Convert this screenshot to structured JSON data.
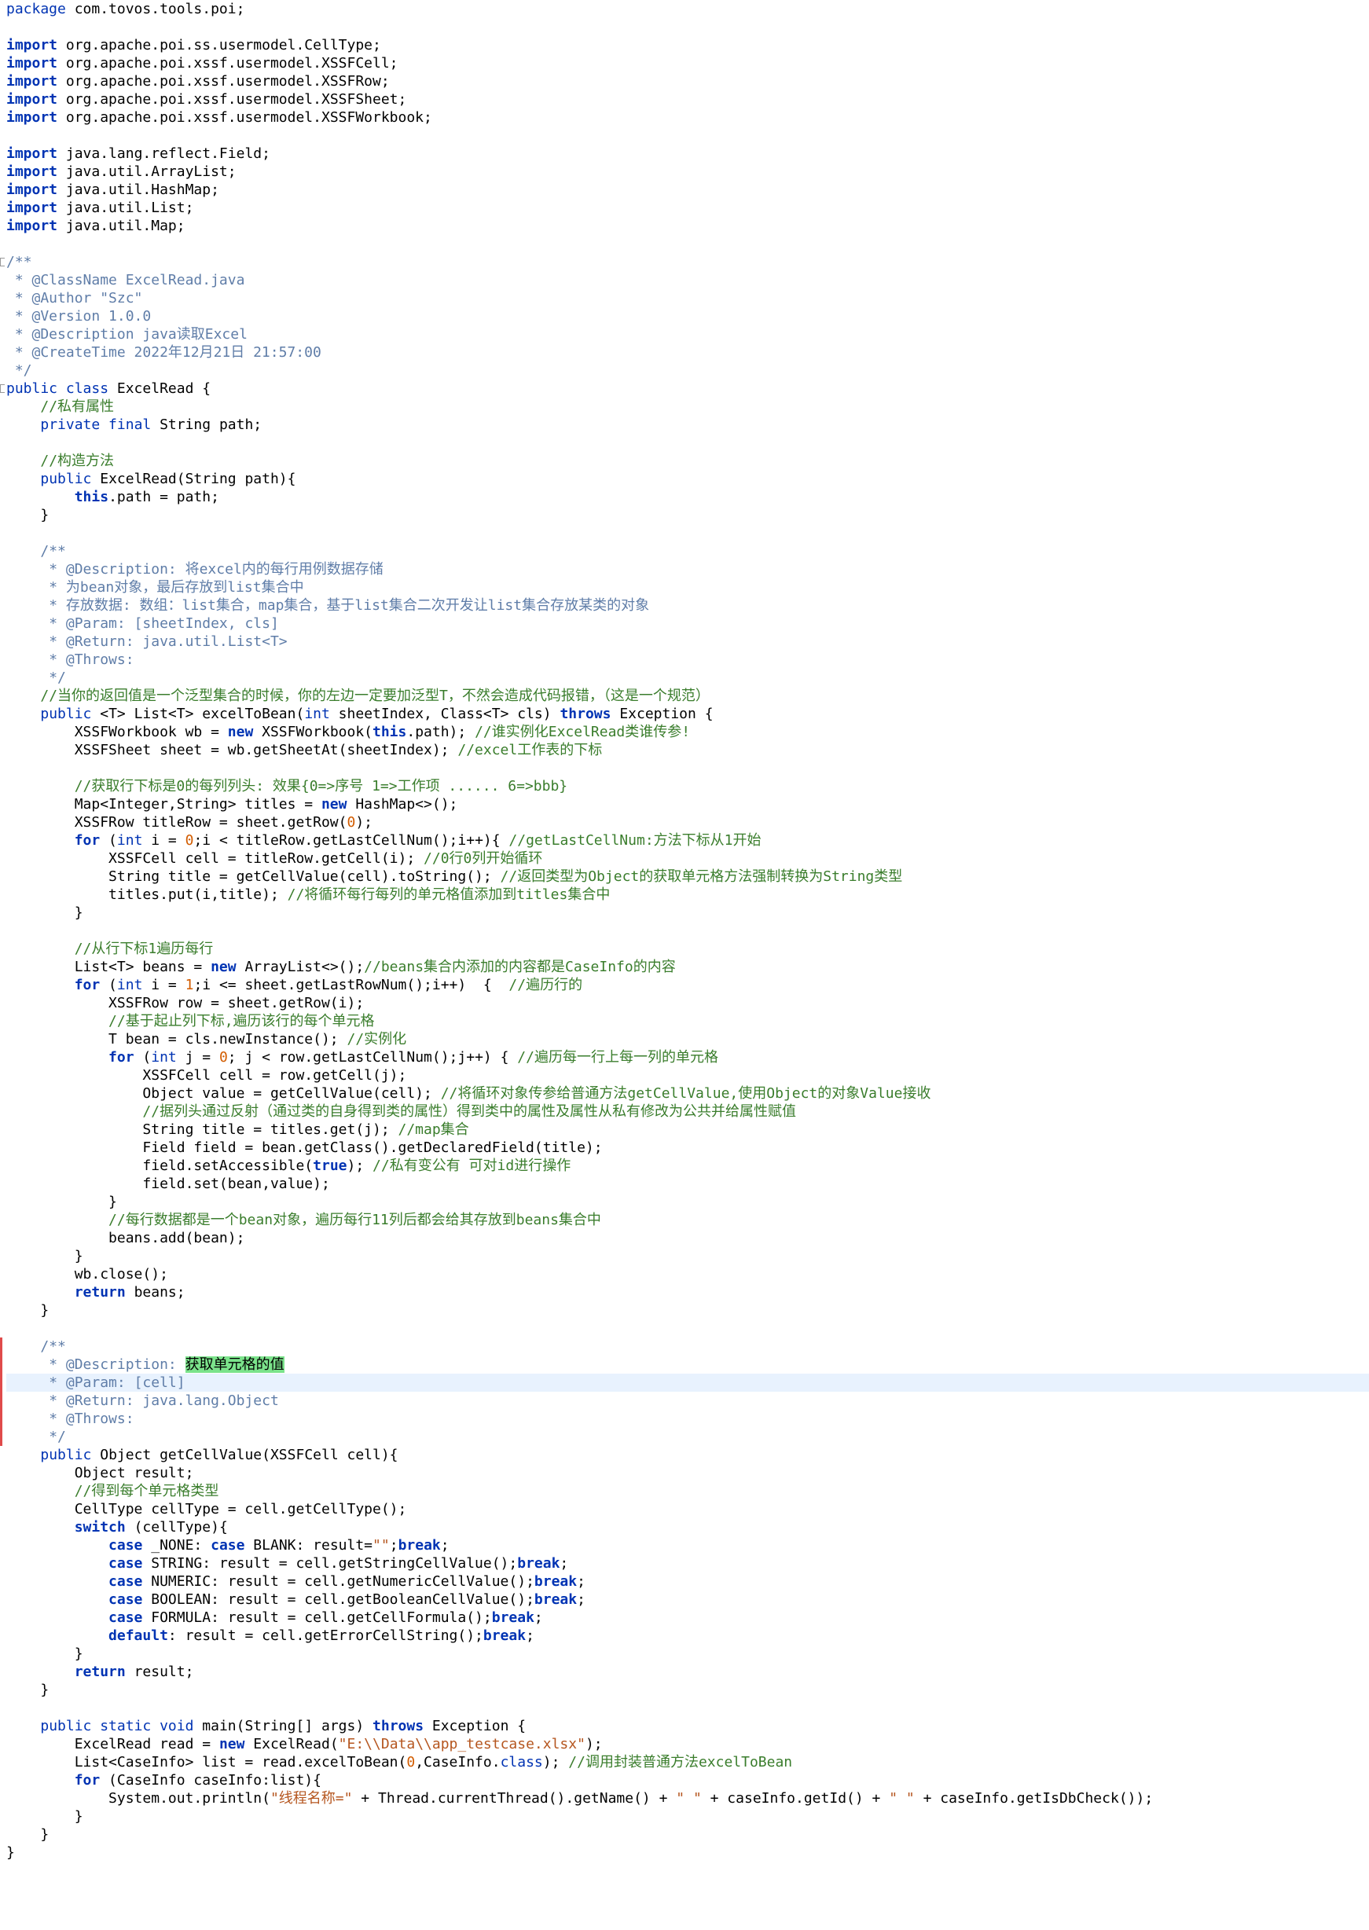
{
  "editor": {
    "lines": [
      [
        [
          "kw",
          "package"
        ],
        [
          "plain",
          " com.tovos.tools.poi;"
        ]
      ],
      [],
      [
        [
          "kwb",
          "import"
        ],
        [
          "plain",
          " org.apache.poi.ss.usermodel.CellType;"
        ]
      ],
      [
        [
          "kwb",
          "import"
        ],
        [
          "plain",
          " org.apache.poi.xssf.usermodel.XSSFCell;"
        ]
      ],
      [
        [
          "kwb",
          "import"
        ],
        [
          "plain",
          " org.apache.poi.xssf.usermodel.XSSFRow;"
        ]
      ],
      [
        [
          "kwb",
          "import"
        ],
        [
          "plain",
          " org.apache.poi.xssf.usermodel.XSSFSheet;"
        ]
      ],
      [
        [
          "kwb",
          "import"
        ],
        [
          "plain",
          " org.apache.poi.xssf.usermodel.XSSFWorkbook;"
        ]
      ],
      [],
      [
        [
          "kwb",
          "import"
        ],
        [
          "plain",
          " java.lang.reflect.Field;"
        ]
      ],
      [
        [
          "kwb",
          "import"
        ],
        [
          "plain",
          " java.util.ArrayList;"
        ]
      ],
      [
        [
          "kwb",
          "import"
        ],
        [
          "plain",
          " java.util.HashMap;"
        ]
      ],
      [
        [
          "kwb",
          "import"
        ],
        [
          "plain",
          " java.util.List;"
        ]
      ],
      [
        [
          "kwb",
          "import"
        ],
        [
          "plain",
          " java.util.Map;"
        ]
      ],
      [],
      [
        [
          "doc",
          "/**"
        ]
      ],
      [
        [
          "doc",
          " * @ClassName ExcelRead.java"
        ]
      ],
      [
        [
          "doc",
          " * @Author \"Szc\""
        ]
      ],
      [
        [
          "doc",
          " * @Version 1.0.0"
        ]
      ],
      [
        [
          "doc",
          " * @Description java读取Excel"
        ]
      ],
      [
        [
          "doc",
          " * @CreateTime 2022年12月21日 21:57:00"
        ]
      ],
      [
        [
          "doc",
          " */"
        ]
      ],
      [
        [
          "kw",
          "public class"
        ],
        [
          "plain",
          " ExcelRead {"
        ]
      ],
      [
        [
          "plain",
          "    "
        ],
        [
          "cm",
          "//私有属性"
        ]
      ],
      [
        [
          "plain",
          "    "
        ],
        [
          "kw",
          "private final"
        ],
        [
          "plain",
          " String path;"
        ]
      ],
      [],
      [
        [
          "plain",
          "    "
        ],
        [
          "cm",
          "//构造方法"
        ]
      ],
      [
        [
          "plain",
          "    "
        ],
        [
          "kw",
          "public"
        ],
        [
          "plain",
          " ExcelRead(String path){"
        ]
      ],
      [
        [
          "plain",
          "        "
        ],
        [
          "kwb",
          "this"
        ],
        [
          "plain",
          ".path = path;"
        ]
      ],
      [
        [
          "plain",
          "    }"
        ]
      ],
      [],
      [
        [
          "plain",
          "    "
        ],
        [
          "doc",
          "/**"
        ]
      ],
      [
        [
          "plain",
          "    "
        ],
        [
          "doc",
          " * @Description: 将excel内的每行用例数据存储"
        ]
      ],
      [
        [
          "plain",
          "    "
        ],
        [
          "doc",
          " * 为bean对象，最后存放到list集合中"
        ]
      ],
      [
        [
          "plain",
          "    "
        ],
        [
          "doc",
          " * 存放数据: 数组：list集合，map集合，基于list集合二次开发让list集合存放某类的对象"
        ]
      ],
      [
        [
          "plain",
          "    "
        ],
        [
          "doc",
          " * @Param: [sheetIndex, cls]"
        ]
      ],
      [
        [
          "plain",
          "    "
        ],
        [
          "doc",
          " * @Return: java.util.List<T>"
        ]
      ],
      [
        [
          "plain",
          "    "
        ],
        [
          "doc",
          " * @Throws:"
        ]
      ],
      [
        [
          "plain",
          "    "
        ],
        [
          "doc",
          " */"
        ]
      ],
      [
        [
          "plain",
          "    "
        ],
        [
          "cm",
          "//当你的返回值是一个泛型集合的时候，你的左边一定要加泛型T，不然会造成代码报错，（这是一个规范）"
        ]
      ],
      [
        [
          "plain",
          "    "
        ],
        [
          "kw",
          "public"
        ],
        [
          "plain",
          " <T> List<T> excelToBean("
        ],
        [
          "kw",
          "int"
        ],
        [
          "plain",
          " sheetIndex, Class<T> cls) "
        ],
        [
          "kwb",
          "throws"
        ],
        [
          "plain",
          " Exception {"
        ]
      ],
      [
        [
          "plain",
          "        XSSFWorkbook wb = "
        ],
        [
          "kwb",
          "new"
        ],
        [
          "plain",
          " XSSFWorkbook("
        ],
        [
          "kwb",
          "this"
        ],
        [
          "plain",
          ".path); "
        ],
        [
          "cm",
          "//谁实例化ExcelRead类谁传参!"
        ]
      ],
      [
        [
          "plain",
          "        XSSFSheet sheet = wb.getSheetAt(sheetIndex); "
        ],
        [
          "cm",
          "//excel工作表的下标"
        ]
      ],
      [],
      [
        [
          "plain",
          "        "
        ],
        [
          "cm",
          "//获取行下标是0的每列列头: 效果{0=>序号 1=>工作项 ...... 6=>bbb}"
        ]
      ],
      [
        [
          "plain",
          "        Map<Integer,String> titles = "
        ],
        [
          "kwb",
          "new"
        ],
        [
          "plain",
          " HashMap<>();"
        ]
      ],
      [
        [
          "plain",
          "        XSSFRow titleRow = sheet.getRow("
        ],
        [
          "num",
          "0"
        ],
        [
          "plain",
          ");"
        ]
      ],
      [
        [
          "plain",
          "        "
        ],
        [
          "kwb",
          "for"
        ],
        [
          "plain",
          " ("
        ],
        [
          "kw",
          "int"
        ],
        [
          "plain",
          " i = "
        ],
        [
          "num",
          "0"
        ],
        [
          "plain",
          ";i < titleRow.getLastCellNum();i++){ "
        ],
        [
          "cm",
          "//getLastCellNum:方法下标从1开始"
        ]
      ],
      [
        [
          "plain",
          "            XSSFCell cell = titleRow.getCell(i); "
        ],
        [
          "cm",
          "//0行0列开始循环"
        ]
      ],
      [
        [
          "plain",
          "            String title = getCellValue(cell).toString(); "
        ],
        [
          "cm",
          "//返回类型为Object的获取单元格方法强制转换为String类型"
        ]
      ],
      [
        [
          "plain",
          "            titles.put(i,title); "
        ],
        [
          "cm",
          "//将循环每行每列的单元格值添加到titles集合中"
        ]
      ],
      [
        [
          "plain",
          "        }"
        ]
      ],
      [],
      [
        [
          "plain",
          "        "
        ],
        [
          "cm",
          "//从行下标1遍历每行"
        ]
      ],
      [
        [
          "plain",
          "        List<T> beans = "
        ],
        [
          "kwb",
          "new"
        ],
        [
          "plain",
          " ArrayList<>();"
        ],
        [
          "cm",
          "//beans集合内添加的内容都是CaseInfo的内容"
        ]
      ],
      [
        [
          "plain",
          "        "
        ],
        [
          "kwb",
          "for"
        ],
        [
          "plain",
          " ("
        ],
        [
          "kw",
          "int"
        ],
        [
          "plain",
          " i = "
        ],
        [
          "num",
          "1"
        ],
        [
          "plain",
          ";i <= sheet.getLastRowNum();i++)  {  "
        ],
        [
          "cm",
          "//遍历行的"
        ]
      ],
      [
        [
          "plain",
          "            XSSFRow row = sheet.getRow(i);"
        ]
      ],
      [
        [
          "plain",
          "            "
        ],
        [
          "cm",
          "//基于起止列下标,遍历该行的每个单元格"
        ]
      ],
      [
        [
          "plain",
          "            T bean = cls.newInstance(); "
        ],
        [
          "cm",
          "//实例化"
        ]
      ],
      [
        [
          "plain",
          "            "
        ],
        [
          "kwb",
          "for"
        ],
        [
          "plain",
          " ("
        ],
        [
          "kw",
          "int"
        ],
        [
          "plain",
          " j = "
        ],
        [
          "num",
          "0"
        ],
        [
          "plain",
          "; j < row.getLastCellNum();j++) { "
        ],
        [
          "cm",
          "//遍历每一行上每一列的单元格"
        ]
      ],
      [
        [
          "plain",
          "                XSSFCell cell = row.getCell(j);"
        ]
      ],
      [
        [
          "plain",
          "                Object value = getCellValue(cell); "
        ],
        [
          "cm",
          "//将循环对象传参给普通方法getCellValue,使用Object的对象Value接收"
        ]
      ],
      [
        [
          "plain",
          "                "
        ],
        [
          "cm",
          "//据列头通过反射（通过类的自身得到类的属性）得到类中的属性及属性从私有修改为公共并给属性赋值"
        ]
      ],
      [
        [
          "plain",
          "                String title = titles.get(j); "
        ],
        [
          "cm",
          "//map集合"
        ]
      ],
      [
        [
          "plain",
          "                Field field = bean.getClass().getDeclaredField(title);"
        ]
      ],
      [
        [
          "plain",
          "                field.setAccessible("
        ],
        [
          "kwb",
          "true"
        ],
        [
          "plain",
          "); "
        ],
        [
          "cm",
          "//私有变公有 可对id进行操作"
        ]
      ],
      [
        [
          "plain",
          "                field.set(bean,value);"
        ]
      ],
      [
        [
          "plain",
          "            }"
        ]
      ],
      [
        [
          "plain",
          "            "
        ],
        [
          "cm",
          "//每行数据都是一个bean对象，遍历每行11列后都会给其存放到beans集合中"
        ]
      ],
      [
        [
          "plain",
          "            beans.add(bean);"
        ]
      ],
      [
        [
          "plain",
          "        }"
        ]
      ],
      [
        [
          "plain",
          "        wb.close();"
        ]
      ],
      [
        [
          "plain",
          "        "
        ],
        [
          "kwb",
          "return"
        ],
        [
          "plain",
          " beans;"
        ]
      ],
      [
        [
          "plain",
          "    }"
        ]
      ],
      [],
      [
        [
          "plain",
          "    "
        ],
        [
          "doc",
          "/**"
        ]
      ],
      [
        [
          "plain",
          "    "
        ],
        [
          "doc",
          " * @Description: "
        ],
        [
          "hl",
          "获取单元格的值"
        ]
      ],
      [
        [
          "plain",
          "    "
        ],
        [
          "doc",
          " * @Param: [cell]"
        ]
      ],
      [
        [
          "plain",
          "    "
        ],
        [
          "doc",
          " * @Return: java.lang.Object"
        ]
      ],
      [
        [
          "plain",
          "    "
        ],
        [
          "doc",
          " * @Throws:"
        ]
      ],
      [
        [
          "plain",
          "    "
        ],
        [
          "doc",
          " */"
        ]
      ],
      [
        [
          "plain",
          "    "
        ],
        [
          "kw",
          "public"
        ],
        [
          "plain",
          " Object getCellValue(XSSFCell cell){"
        ]
      ],
      [
        [
          "plain",
          "        Object result;"
        ]
      ],
      [
        [
          "plain",
          "        "
        ],
        [
          "cm",
          "//得到每个单元格类型"
        ]
      ],
      [
        [
          "plain",
          "        CellType cellType = cell.getCellType();"
        ]
      ],
      [
        [
          "plain",
          "        "
        ],
        [
          "kwb",
          "switch"
        ],
        [
          "plain",
          " (cellType){"
        ]
      ],
      [
        [
          "plain",
          "            "
        ],
        [
          "kwb",
          "case"
        ],
        [
          "plain",
          " _NONE: "
        ],
        [
          "kwb",
          "case"
        ],
        [
          "plain",
          " BLANK: result="
        ],
        [
          "str",
          "\"\""
        ],
        [
          "plain",
          ";"
        ],
        [
          "kwb",
          "break"
        ],
        [
          "plain",
          ";"
        ]
      ],
      [
        [
          "plain",
          "            "
        ],
        [
          "kwb",
          "case"
        ],
        [
          "plain",
          " STRING: result = cell.getStringCellValue();"
        ],
        [
          "kwb",
          "break"
        ],
        [
          "plain",
          ";"
        ]
      ],
      [
        [
          "plain",
          "            "
        ],
        [
          "kwb",
          "case"
        ],
        [
          "plain",
          " NUMERIC: result = cell.getNumericCellValue();"
        ],
        [
          "kwb",
          "break"
        ],
        [
          "plain",
          ";"
        ]
      ],
      [
        [
          "plain",
          "            "
        ],
        [
          "kwb",
          "case"
        ],
        [
          "plain",
          " BOOLEAN: result = cell.getBooleanCellValue();"
        ],
        [
          "kwb",
          "break"
        ],
        [
          "plain",
          ";"
        ]
      ],
      [
        [
          "plain",
          "            "
        ],
        [
          "kwb",
          "case"
        ],
        [
          "plain",
          " FORMULA: result = cell.getCellFormula();"
        ],
        [
          "kwb",
          "break"
        ],
        [
          "plain",
          ";"
        ]
      ],
      [
        [
          "plain",
          "            "
        ],
        [
          "kwb",
          "default"
        ],
        [
          "plain",
          ": result = cell.getErrorCellString();"
        ],
        [
          "kwb",
          "break"
        ],
        [
          "plain",
          ";"
        ]
      ],
      [
        [
          "plain",
          "        }"
        ]
      ],
      [
        [
          "plain",
          "        "
        ],
        [
          "kwb",
          "return"
        ],
        [
          "plain",
          " result;"
        ]
      ],
      [
        [
          "plain",
          "    }"
        ]
      ],
      [],
      [
        [
          "plain",
          "    "
        ],
        [
          "kw",
          "public static void"
        ],
        [
          "plain",
          " main(String[] args) "
        ],
        [
          "kwb",
          "throws"
        ],
        [
          "plain",
          " Exception {"
        ]
      ],
      [
        [
          "plain",
          "        ExcelRead read = "
        ],
        [
          "kwb",
          "new"
        ],
        [
          "plain",
          " ExcelRead("
        ],
        [
          "str",
          "\"E:\\\\Data\\\\app_testcase.xlsx\""
        ],
        [
          "plain",
          ");"
        ]
      ],
      [
        [
          "plain",
          "        List<CaseInfo> list = read.excelToBean("
        ],
        [
          "num",
          "0"
        ],
        [
          "plain",
          ",CaseInfo."
        ],
        [
          "kw",
          "class"
        ],
        [
          "plain",
          "); "
        ],
        [
          "cm",
          "//调用封装普通方法excelToBean"
        ]
      ],
      [
        [
          "plain",
          "        "
        ],
        [
          "kwb",
          "for"
        ],
        [
          "plain",
          " (CaseInfo caseInfo:list){"
        ]
      ],
      [
        [
          "plain",
          "            System.out.println("
        ],
        [
          "str",
          "\"线程名称=\""
        ],
        [
          "plain",
          " + Thread.currentThread().getName() + "
        ],
        [
          "str",
          "\" \""
        ],
        [
          "plain",
          " + caseInfo.getId() + "
        ],
        [
          "str",
          "\" \""
        ],
        [
          "plain",
          " + caseInfo.getIsDbCheck());"
        ]
      ],
      [
        [
          "plain",
          "        }"
        ]
      ],
      [
        [
          "plain",
          "    }"
        ]
      ],
      [
        [
          "plain",
          "}"
        ]
      ]
    ],
    "current_line": 76
  }
}
